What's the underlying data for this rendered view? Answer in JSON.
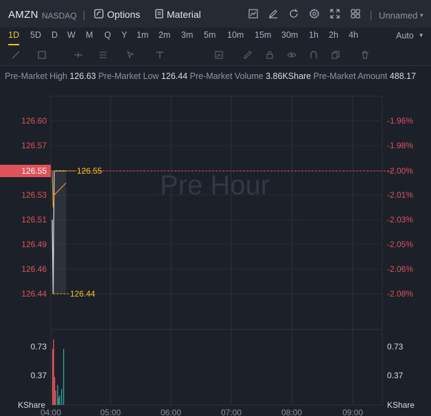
{
  "header": {
    "symbol": "AMZN",
    "exchange": "NASDAQ",
    "options_label": "Options",
    "material_label": "Material",
    "layout_name": "Unnamed"
  },
  "timeframes": [
    "1D",
    "5D",
    "D",
    "W",
    "M",
    "Q",
    "Y",
    "1m",
    "2m",
    "3m",
    "5m",
    "10m",
    "15m",
    "30m",
    "1h",
    "2h",
    "4h"
  ],
  "active_timeframe": "1D",
  "auto_label": "Auto",
  "premarket": {
    "high_label": "Pre-Market High",
    "high_value": "126.63",
    "low_label": "Pre-Market Low",
    "low_value": "126.44",
    "volume_label": "Pre-Market Volume",
    "volume_value": "3.86KShare",
    "amount_label": "Pre-Market Amount",
    "amount_value": "488.17"
  },
  "watermark": "Pre Hour",
  "colors": {
    "up": "#26a69a",
    "down": "#e0525a",
    "price_line": "#c9ced6",
    "avg_line": "#e89a2c",
    "highlight": "#f5c518"
  },
  "chart_data": {
    "type": "line",
    "price_axis": {
      "ticks": [
        "126.60",
        "126.57",
        "126.55",
        "126.53",
        "126.51",
        "126.49",
        "126.46",
        "126.44"
      ],
      "percent_ticks": [
        "-1.96%",
        "-1.98%",
        "-2.00%",
        "-2.01%",
        "-2.03%",
        "-2.05%",
        "-2.06%",
        "-2.08%"
      ],
      "current_price": "126.55",
      "current_percent": "-2.00%",
      "high_marker": "126.55",
      "low_marker": "126.44"
    },
    "volume_axis": {
      "ticks": [
        "0.73",
        "0.37"
      ],
      "unit": "KShare"
    },
    "time_axis": [
      "04:00",
      "05:00",
      "06:00",
      "07:00",
      "08:00",
      "09:00"
    ],
    "price_series": [
      {
        "t": "04:00",
        "price": 126.51
      },
      {
        "t": "04:01",
        "price": 126.44
      },
      {
        "t": "04:02",
        "price": 126.55
      },
      {
        "t": "04:14",
        "price": 126.55
      }
    ],
    "avg_series": [
      {
        "t": "04:00",
        "price": 126.55
      },
      {
        "t": "04:01",
        "price": 126.52
      },
      {
        "t": "04:02",
        "price": 126.53
      },
      {
        "t": "04:14",
        "price": 126.54
      }
    ],
    "volume_series": [
      {
        "t": "04:00",
        "value": 0.7,
        "dir": "down"
      },
      {
        "t": "04:01",
        "value": 0.82,
        "dir": "down"
      },
      {
        "t": "04:02",
        "value": 0.35,
        "dir": "down"
      },
      {
        "t": "04:03",
        "value": 0.18,
        "dir": "down"
      },
      {
        "t": "04:05",
        "value": 0.25,
        "dir": "up"
      },
      {
        "t": "04:06",
        "value": 0.09,
        "dir": "up"
      },
      {
        "t": "04:07",
        "value": 0.12,
        "dir": "up"
      },
      {
        "t": "04:09",
        "value": 0.2,
        "dir": "up"
      },
      {
        "t": "04:11",
        "value": 0.7,
        "dir": "up"
      }
    ]
  }
}
